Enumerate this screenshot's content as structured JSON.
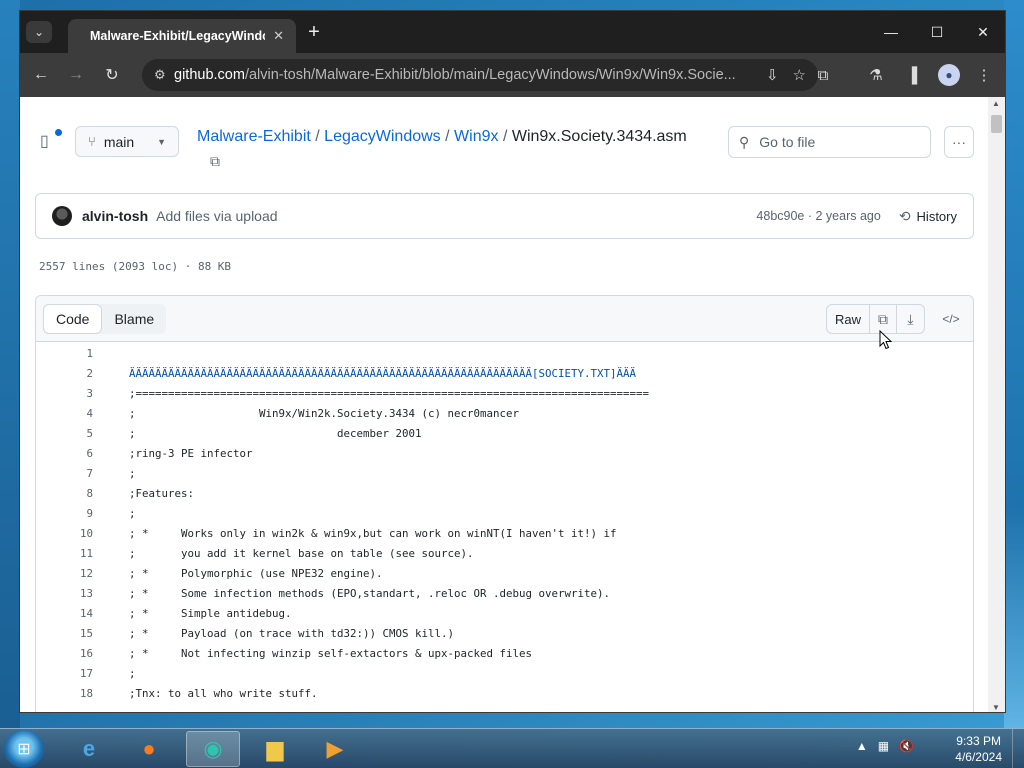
{
  "browser": {
    "tab_title": "Malware-Exhibit/LegacyWindo",
    "url_host": "github.com",
    "url_path": "/alvin-tosh/Malware-Exhibit/blob/main/LegacyWindows/Win9x/Win9x.Socie..."
  },
  "repo": {
    "branch": "main",
    "breadcrumbs": [
      "Malware-Exhibit",
      "LegacyWindows",
      "Win9x"
    ],
    "separator": "/",
    "file_name": "Win9x.Society.3434.asm",
    "goto_placeholder": "Go to file"
  },
  "commit": {
    "author": "alvin-tosh",
    "message": "Add files via upload",
    "meta": "48bc90e · 2 years ago",
    "history_label": "History"
  },
  "file_stats": "2557 lines (2093 loc) · 88 KB",
  "code_view": {
    "tab_code": "Code",
    "tab_blame": "Blame",
    "raw_label": "Raw"
  },
  "code_lines": [
    {
      "n": "1",
      "text": ""
    },
    {
      "n": "2",
      "text": "ÄÄÄÄÄÄÄÄÄÄÄÄÄÄÄÄÄÄÄÄÄÄÄÄÄÄÄÄÄÄÄÄÄÄÄÄÄÄÄÄÄÄÄÄÄÄÄÄÄÄÄÄÄÄÄÄÄÄÄÄÄÄ[SOCIETY.TXT]ÄÄÄ"
    },
    {
      "n": "3",
      "text": ";==============================================================================="
    },
    {
      "n": "4",
      "text": ";                   Win9x/Win2k.Society.3434 (c) necr0mancer"
    },
    {
      "n": "5",
      "text": ";                               december 2001"
    },
    {
      "n": "6",
      "text": ";ring-3 PE infector"
    },
    {
      "n": "7",
      "text": ";"
    },
    {
      "n": "8",
      "text": ";Features:"
    },
    {
      "n": "9",
      "text": ";"
    },
    {
      "n": "10",
      "text": "; *     Works only in win2k & win9x,but can work on winNT(I haven't it!) if"
    },
    {
      "n": "11",
      "text": ";       you add it kernel base on table (see source)."
    },
    {
      "n": "12",
      "text": "; *     Polymorphic (use NPE32 engine)."
    },
    {
      "n": "13",
      "text": "; *     Some infection methods (EPO,standart, .reloc OR .debug overwrite)."
    },
    {
      "n": "14",
      "text": "; *     Simple antidebug."
    },
    {
      "n": "15",
      "text": "; *     Payload (on trace with td32:)) CMOS kill.)"
    },
    {
      "n": "16",
      "text": "; *     Not infecting winzip self-extactors & upx-packed files"
    },
    {
      "n": "17",
      "text": ";"
    },
    {
      "n": "18",
      "text": ";Tnx: to all who write stuff."
    }
  ],
  "taskbar": {
    "time": "9:33 PM",
    "date": "4/6/2024"
  }
}
